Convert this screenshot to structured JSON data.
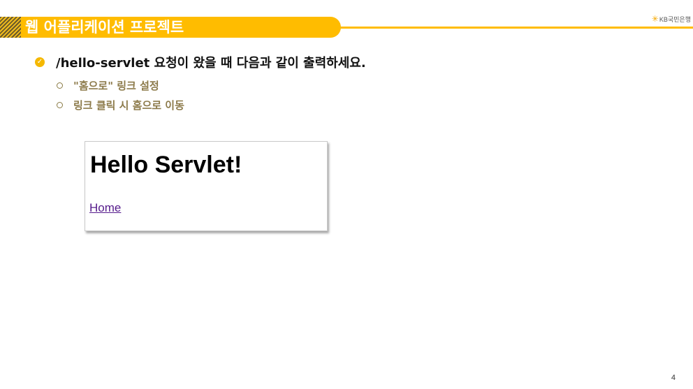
{
  "header": {
    "title": "웹 어플리케이션 프로젝트",
    "logo_text": "KB국민은행",
    "accent_color": "#ffbc00"
  },
  "content": {
    "main_bullet": "/hello-servlet 요청이 왔을 때 다음과 같이 출력하세요.",
    "sub_bullets": [
      "\"홈으로\" 링크 설정",
      "링크 클릭 시 홈으로 이동"
    ]
  },
  "browser": {
    "heading": "Hello Servlet!",
    "link_text": "Home"
  },
  "page_number": "4"
}
